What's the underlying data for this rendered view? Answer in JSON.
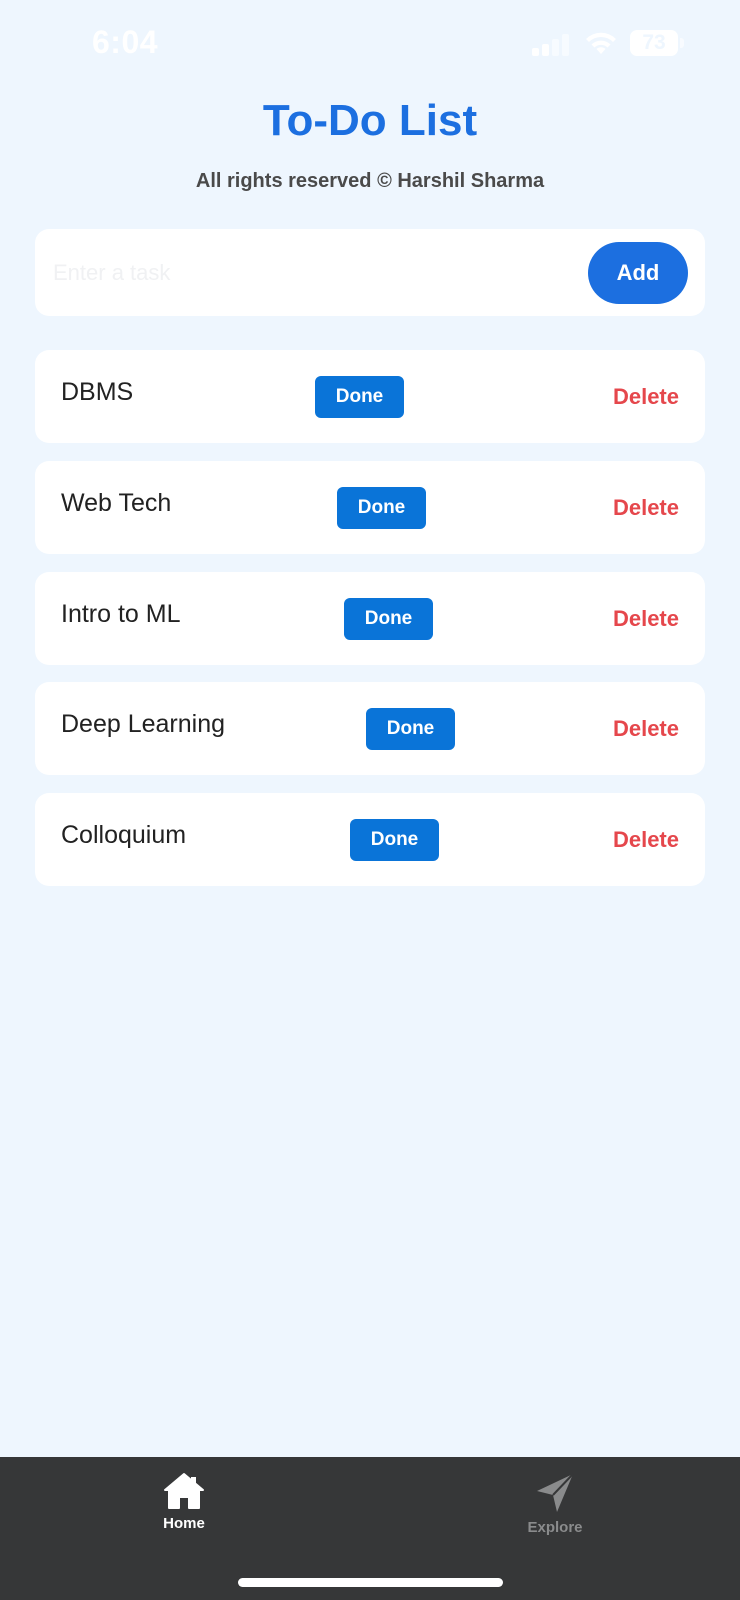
{
  "status_bar": {
    "time": "6:04",
    "battery": "73"
  },
  "header": {
    "title": "To-Do List",
    "subtitle": "All rights reserved © Harshil Sharma"
  },
  "task_input": {
    "placeholder": "Enter a task",
    "value": "",
    "add_label": "Add"
  },
  "tasks": [
    {
      "name": "DBMS",
      "done_label": "Done",
      "delete_label": "Delete"
    },
    {
      "name": "Web Tech",
      "done_label": "Done",
      "delete_label": "Delete"
    },
    {
      "name": "Intro to ML",
      "done_label": "Done",
      "delete_label": "Delete"
    },
    {
      "name": "Deep Learning",
      "done_label": "Done",
      "delete_label": "Delete"
    },
    {
      "name": "Colloquium",
      "done_label": "Done",
      "delete_label": "Delete"
    }
  ],
  "bottom_nav": {
    "items": [
      {
        "label": "Home",
        "icon": "home-icon",
        "active": true
      },
      {
        "label": "Explore",
        "icon": "paper-plane-icon",
        "active": false
      }
    ]
  },
  "colors": {
    "background": "#eef6fe",
    "primary": "#1c6fe0",
    "done_button": "#0a74d8",
    "delete_text": "#e5474c",
    "nav_background": "#363738"
  }
}
